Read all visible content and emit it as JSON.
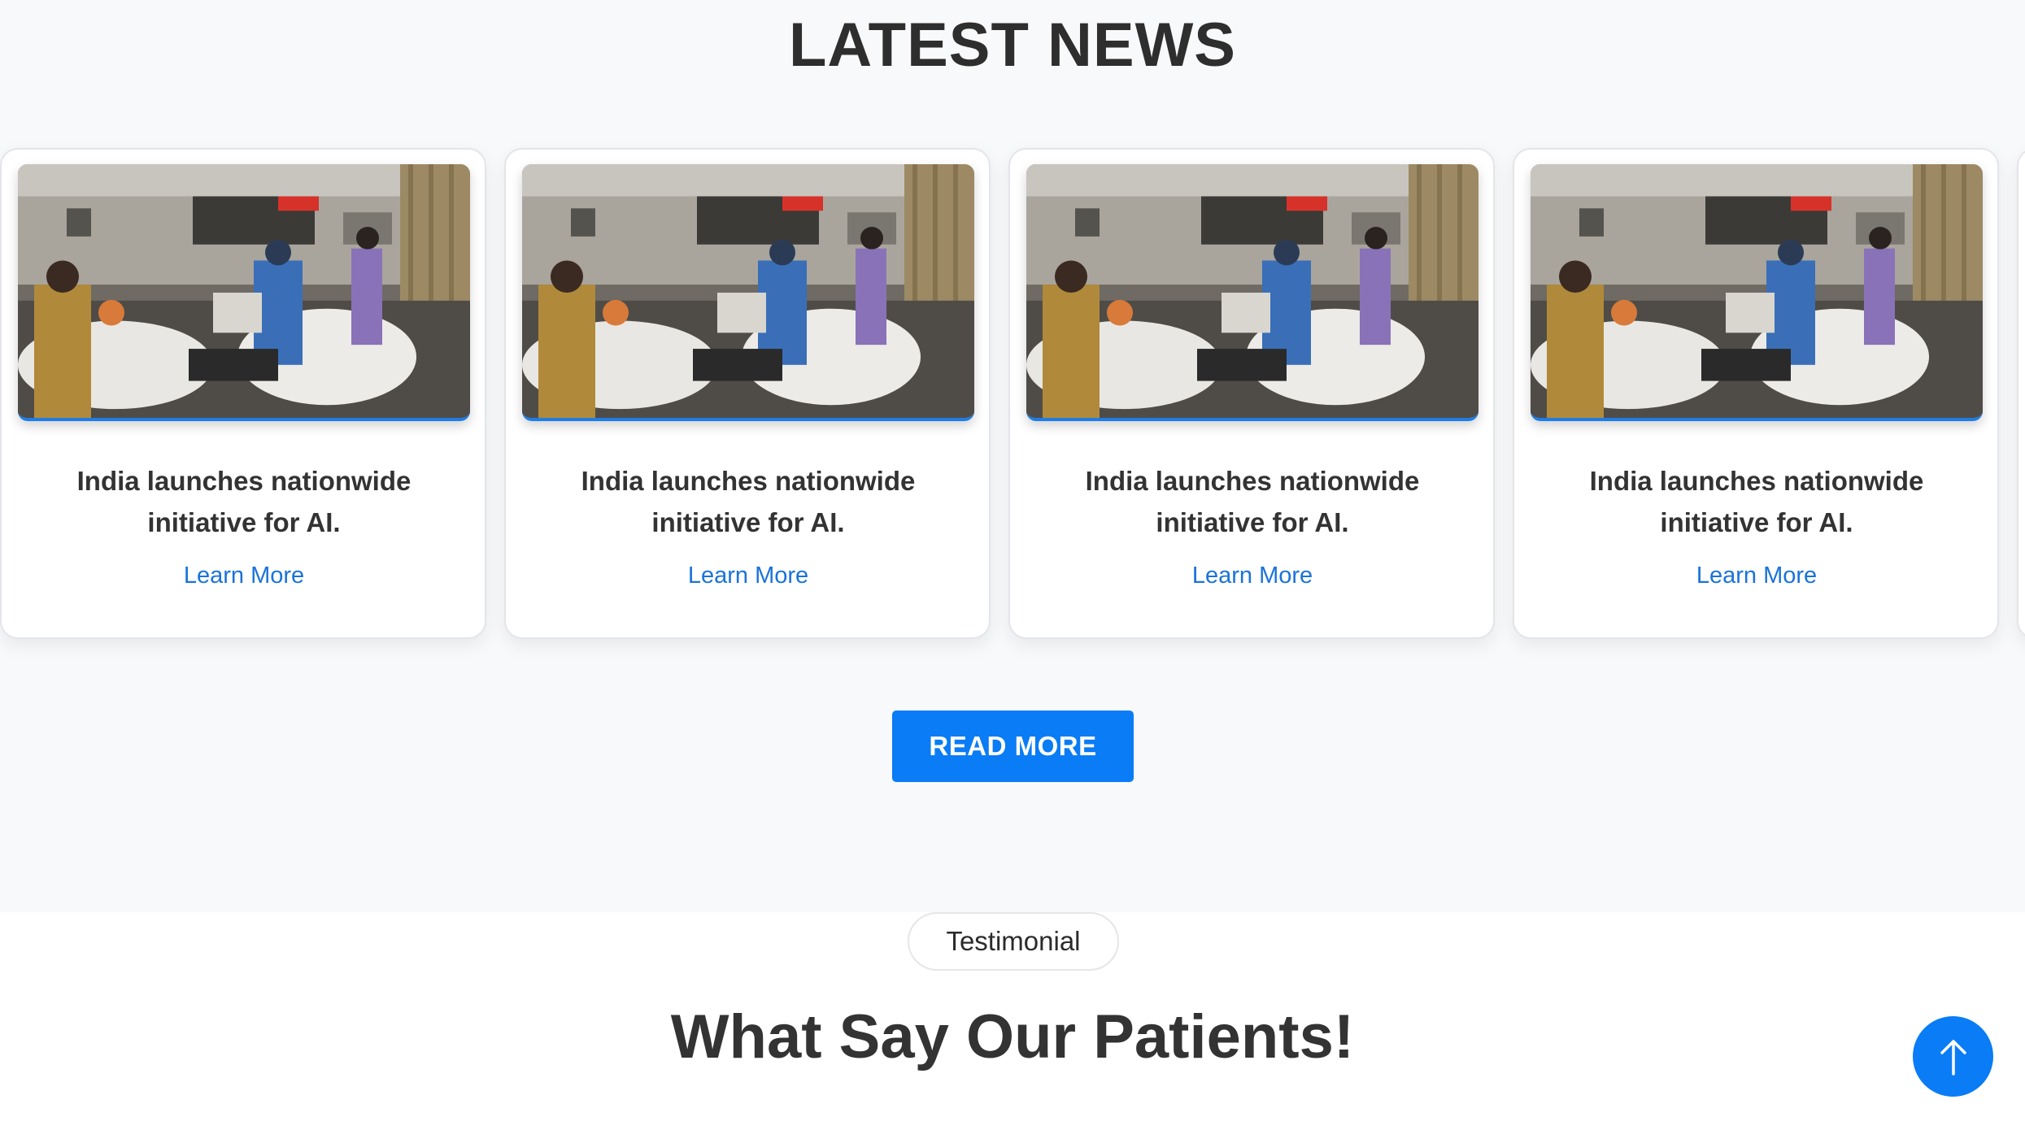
{
  "news": {
    "title": "LATEST NEWS",
    "cards": [
      {
        "headline": "India launches nationwide initiative for AI.",
        "link": "Learn More"
      },
      {
        "headline": "India launches nationwide initiative for AI.",
        "link": "Learn More"
      },
      {
        "headline": "India launches nationwide initiative for AI.",
        "link": "Learn More"
      },
      {
        "headline": "India launches nationwide initiative for AI.",
        "link": "Learn More"
      }
    ],
    "read_more": "READ MORE"
  },
  "testimonial": {
    "tag": "Testimonial",
    "title": "What Say Our Patients!"
  },
  "icons": {
    "card_image": "hospital-ward-photo",
    "scroll_top": "arrow-up-icon"
  },
  "colors": {
    "accent": "#0a7cf5",
    "link": "#1a73d9",
    "section_bg": "#f8f9fb"
  }
}
